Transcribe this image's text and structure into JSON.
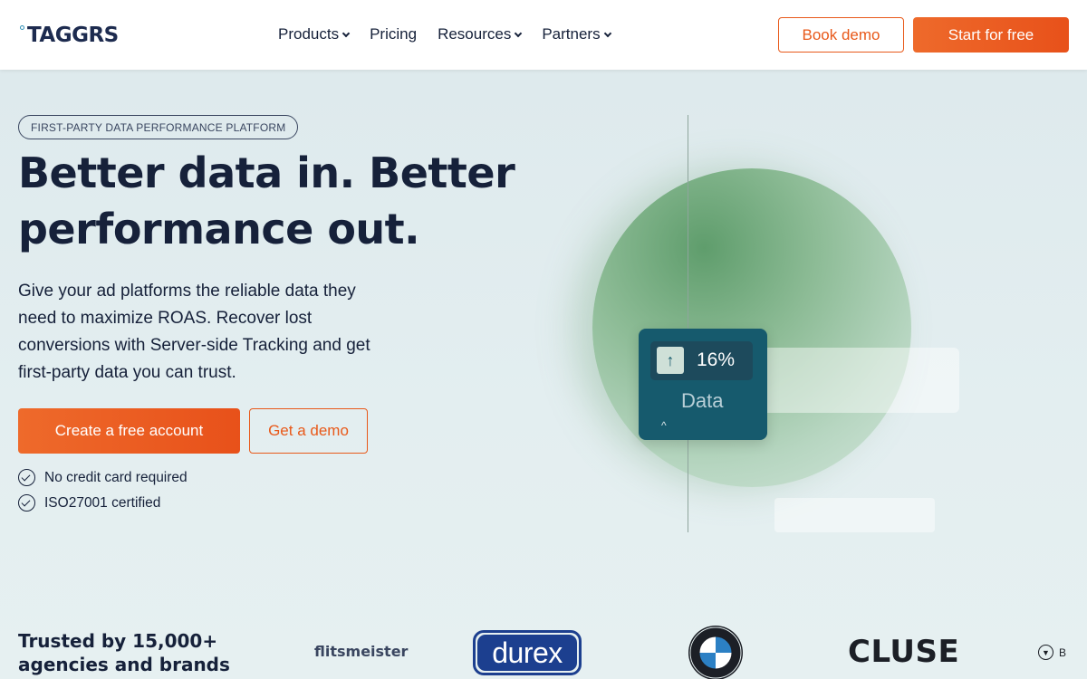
{
  "header": {
    "logo_text": "TAGGRS",
    "nav": [
      {
        "label": "Products",
        "has_dropdown": true
      },
      {
        "label": "Pricing",
        "has_dropdown": false
      },
      {
        "label": "Resources",
        "has_dropdown": true
      },
      {
        "label": "Partners",
        "has_dropdown": true
      }
    ],
    "book_demo_label": "Book demo",
    "start_free_label": "Start for free"
  },
  "hero": {
    "badge": "FIRST-PARTY DATA PERFORMANCE PLATFORM",
    "headline_line1": "Better data in. Better",
    "headline_line2": "performance out.",
    "subtitle": "Give your ad platforms the reliable data they need to maximize ROAS. Recover lost conversions with Server-side Tracking and get first-party data you can trust.",
    "create_account_label": "Create a free account",
    "get_demo_label": "Get a demo",
    "checks": [
      "No credit card required",
      "ISO27001 certified"
    ]
  },
  "illustration": {
    "percent": "16%",
    "label": "Data",
    "caret": "^"
  },
  "trusted": {
    "title": "Trusted by 15,000+ agencies and brands",
    "logos": [
      "flitsmeister",
      "durex",
      "BMW",
      "CLUSE",
      "B"
    ]
  },
  "colors": {
    "accent": "#e8591a",
    "navy": "#16213a",
    "card": "#165a6d"
  }
}
